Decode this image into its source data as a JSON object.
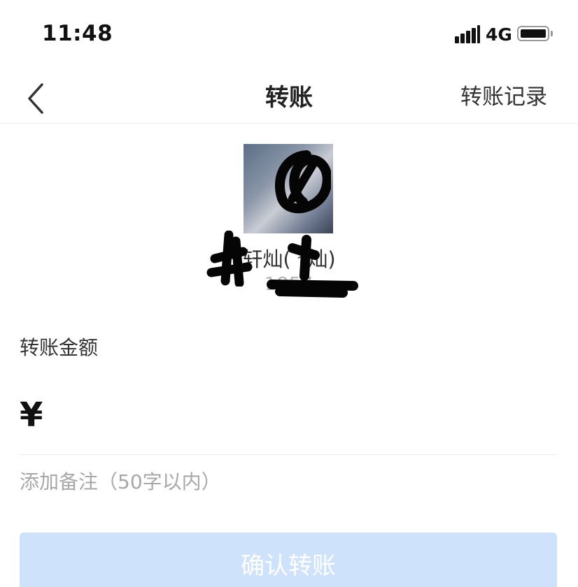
{
  "status_bar": {
    "time": "11:48",
    "network": "4G",
    "icons": [
      "signal-icon",
      "battery-icon"
    ]
  },
  "nav": {
    "back_icon": "chevron-left-icon",
    "title": "转账",
    "right_link": "转账记录"
  },
  "recipient": {
    "name": "轩灿( *灿)",
    "phone": "1857"
  },
  "amount": {
    "label": "转账金额",
    "currency": "¥",
    "value": ""
  },
  "remark": {
    "placeholder": "添加备注（50字以内）"
  },
  "confirm": {
    "label": "确认转账"
  },
  "colors": {
    "button_disabled_bg": "#cfe2fb",
    "placeholder_text": "#a8a8a8",
    "divider": "#ececec"
  }
}
